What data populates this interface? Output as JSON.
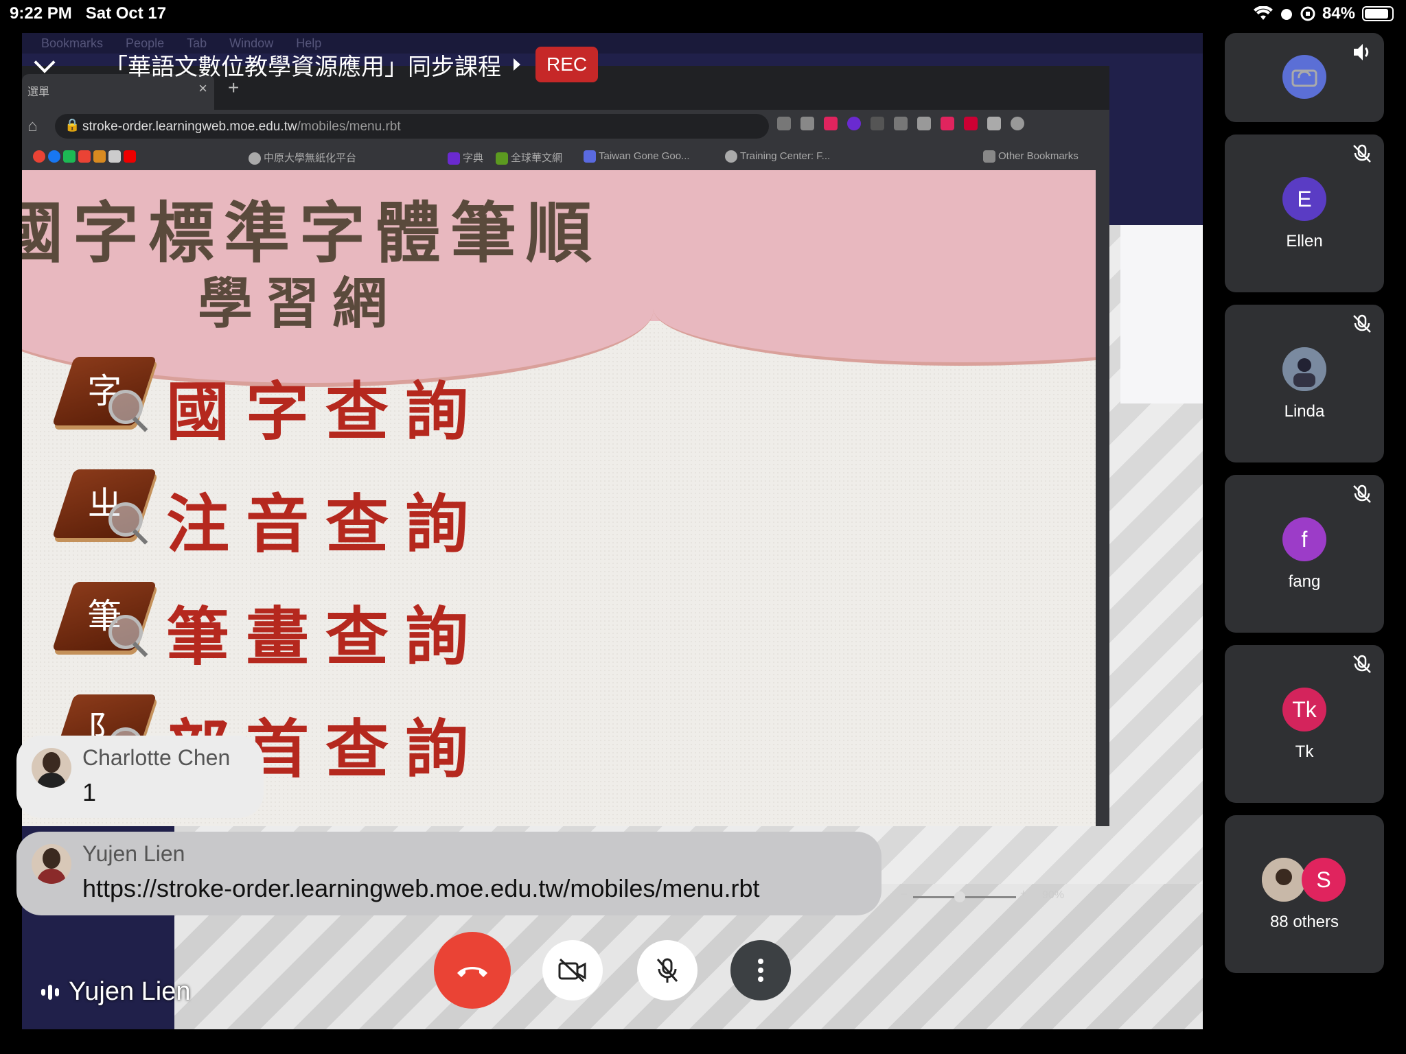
{
  "status_bar": {
    "time": "9:22 PM",
    "date": "Sat Oct 17",
    "battery": "84%"
  },
  "mac_menu": [
    "Bookmarks",
    "People",
    "Tab",
    "Window",
    "Help"
  ],
  "meeting": {
    "title": "「華語文數位教學資源應用」同步課程",
    "rec_label": "REC"
  },
  "browser": {
    "tab_title": "選單",
    "url_host": "stroke-order.learningweb.moe.edu.tw",
    "url_path": "/mobiles/menu.rbt",
    "bookmarks": [
      "中原大學無紙化平台",
      "字典",
      "全球華文網",
      "Taiwan Gone Goo...",
      "Training Center: F..."
    ],
    "other_bookmarks": "Other Bookmarks"
  },
  "page": {
    "site_title": "國字標準字體筆順",
    "site_subtitle": "學習網",
    "menu": [
      {
        "glyph": "字",
        "label": "國字查詢"
      },
      {
        "glyph": "ㄓ",
        "label": "注音查詢"
      },
      {
        "glyph": "筆",
        "label": "筆畫查詢"
      },
      {
        "glyph": "阝",
        "label": "部首查詢"
      }
    ]
  },
  "zoom_level": "90%",
  "chat": [
    {
      "name": "Charlotte Chen",
      "message": "1"
    },
    {
      "name": "Yujen Lien",
      "message": "https://stroke-order.learningweb.moe.edu.tw/mobiles/menu.rbt"
    }
  ],
  "speaker_name": "Yujen Lien",
  "participants": [
    {
      "name": "",
      "initial": "",
      "color": "#5b6fd6"
    },
    {
      "name": "Ellen",
      "initial": "E",
      "color": "#5a3cc4"
    },
    {
      "name": "Linda",
      "initial": "",
      "color": "#4a5a70"
    },
    {
      "name": "fang",
      "initial": "f",
      "color": "#9c3cc8"
    },
    {
      "name": "Tk",
      "initial": "Tk",
      "color": "#d4245c"
    },
    {
      "name": "88 others",
      "initial": "S",
      "color": "#e0245e"
    }
  ],
  "colors": {
    "end_call": "#ea4335",
    "rec": "#c62828",
    "menu_text": "#b5281e"
  }
}
